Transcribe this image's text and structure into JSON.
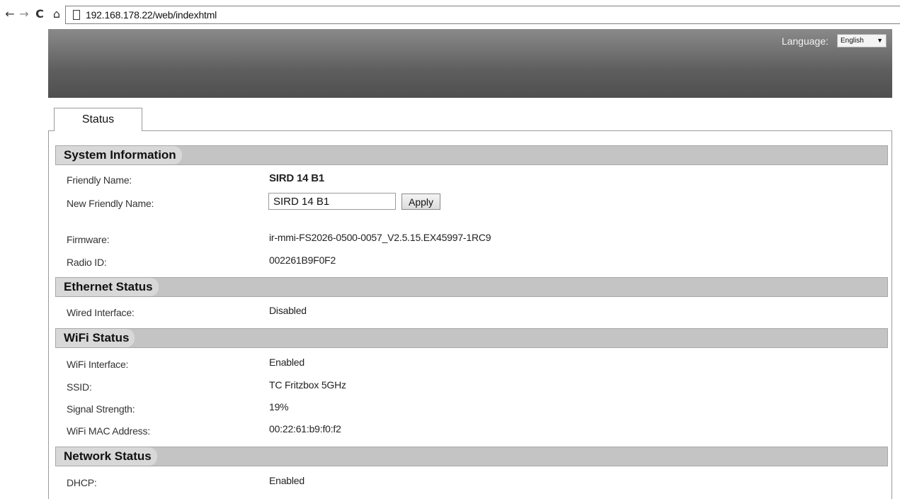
{
  "browser": {
    "back_glyph": "←",
    "forward_glyph": "→",
    "reload_glyph": "C",
    "home_glyph": "⌂",
    "url": "192.168.178.22/web/indexhtml"
  },
  "header": {
    "language_label": "Language:",
    "language_value": "English",
    "select_arrow": "▼"
  },
  "tabs": [
    {
      "label": "Status"
    }
  ],
  "system_information": {
    "title": "System Information",
    "friendly_name_label": "Friendly Name:",
    "friendly_name_value": "SIRD 14 B1",
    "new_friendly_name_label": "New Friendly Name:",
    "new_friendly_name_input": "SIRD 14 B1",
    "apply_label": "Apply",
    "firmware_label": "Firmware:",
    "firmware_value": "ir-mmi-FS2026-0500-0057_V2.5.15.EX45997-1RC9",
    "radio_id_label": "Radio ID:",
    "radio_id_value": "002261B9F0F2"
  },
  "ethernet_status": {
    "title": "Ethernet Status",
    "wired_interface_label": "Wired Interface:",
    "wired_interface_value": "Disabled"
  },
  "wifi_status": {
    "title": "WiFi Status",
    "wifi_interface_label": "WiFi Interface:",
    "wifi_interface_value": "Enabled",
    "ssid_label": "SSID:",
    "ssid_value": "TC Fritzbox 5GHz",
    "signal_strength_label": "Signal Strength:",
    "signal_strength_value": "19%",
    "mac_label": "WiFi MAC Address:",
    "mac_value": "00:22:61:b9:f0:f2"
  },
  "network_status": {
    "title": "Network Status",
    "dhcp_label": "DHCP:",
    "dhcp_value": "Enabled"
  }
}
